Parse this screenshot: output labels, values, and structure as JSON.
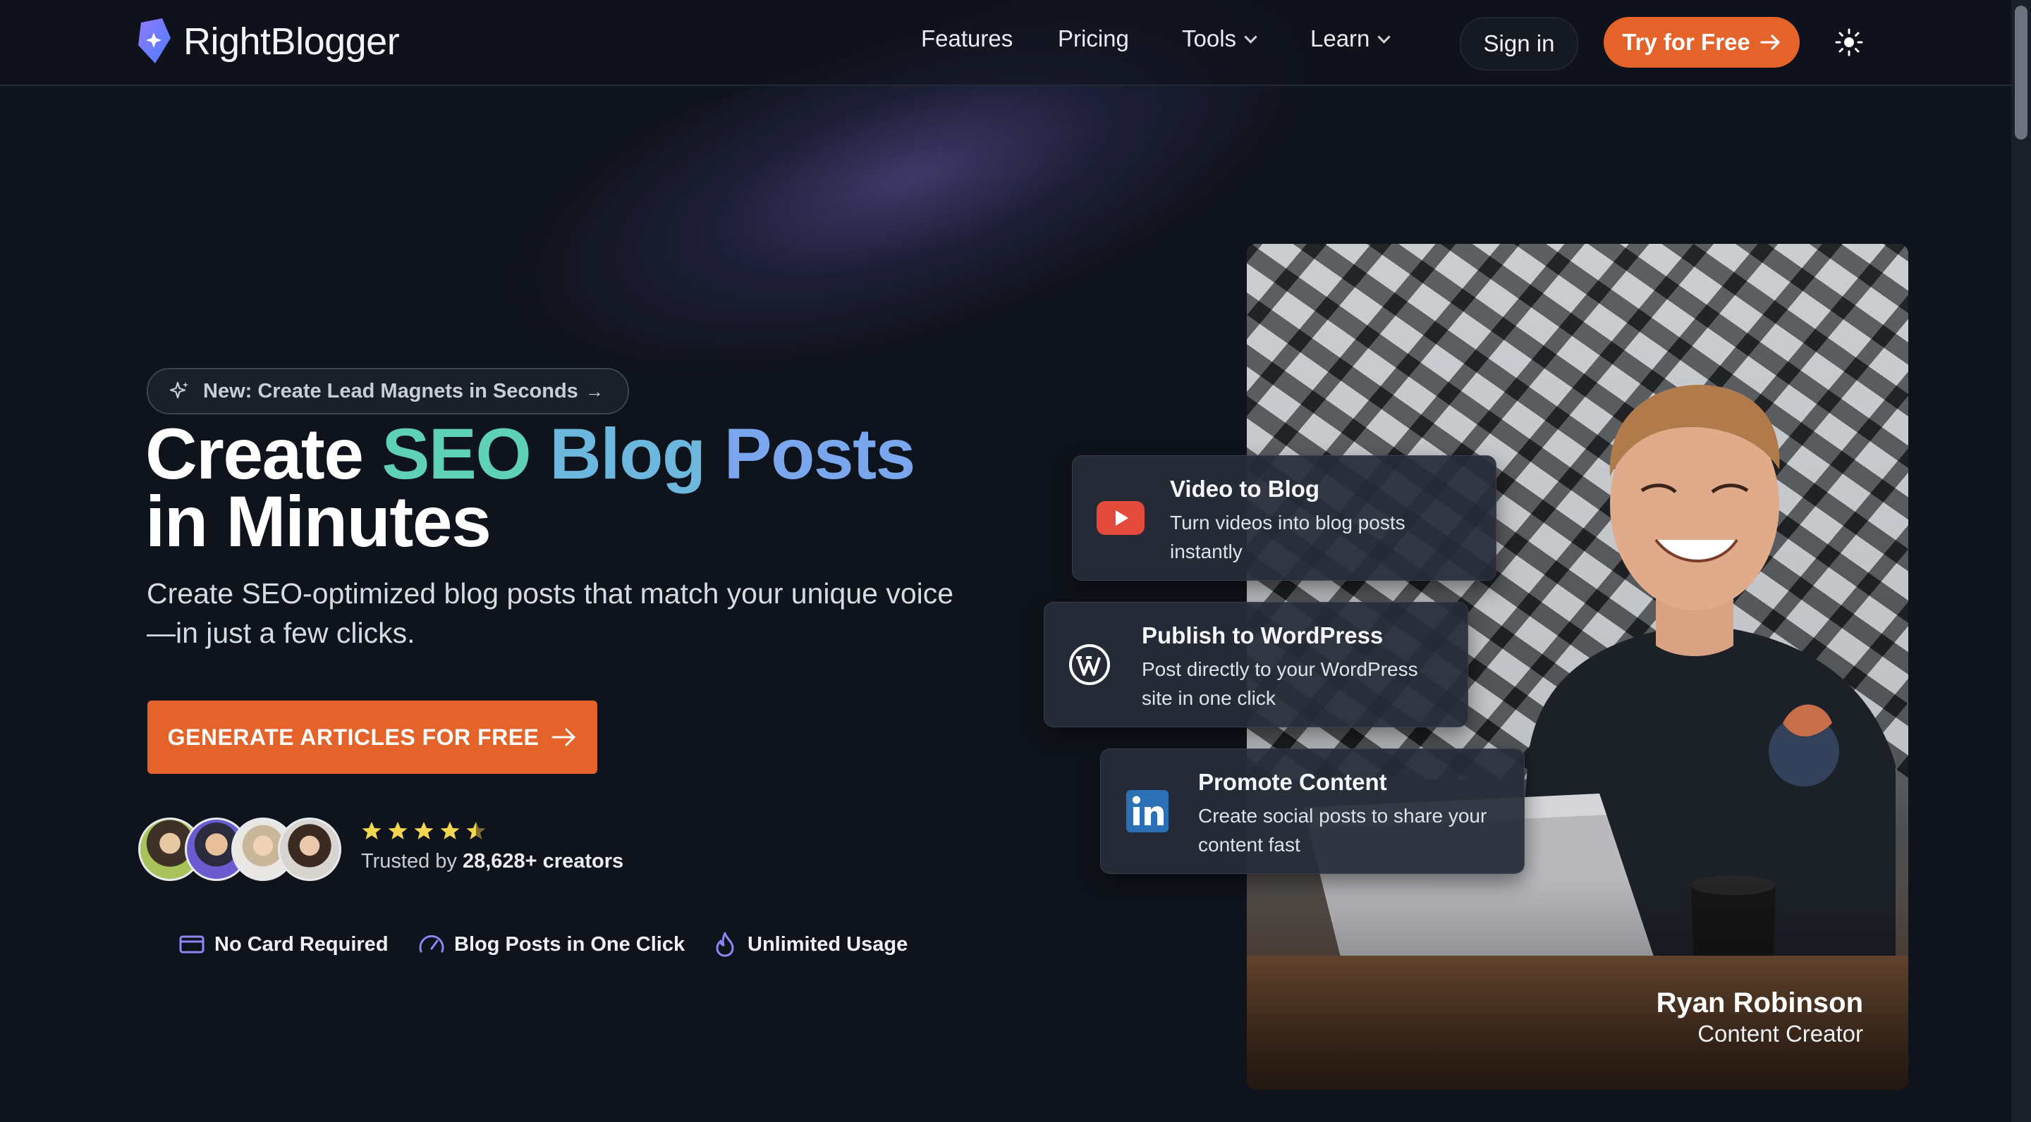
{
  "nav": {
    "logo_text": "RightBlogger",
    "links": [
      {
        "label": "Features"
      },
      {
        "label": "Pricing"
      },
      {
        "label": "Tools"
      },
      {
        "label": "Learn"
      }
    ],
    "sign_in": "Sign in",
    "try_free": "Try for Free"
  },
  "hero": {
    "badge": "New: Create Lead Magnets in Seconds",
    "headline_part1": "Create ",
    "headline_seo": "SEO",
    "headline_blog": "Blog",
    "headline_posts": "Posts",
    "headline_line2": "in Minutes",
    "subtitle": "Create SEO-optimized blog posts that match your unique voice—in just a few clicks.",
    "cta": "GENERATE ARTICLES FOR FREE",
    "rating_stars": 4.5,
    "trusted_prefix": "Trusted by ",
    "trusted_count": "28,628+ creators",
    "features": [
      {
        "label": "No Card Required",
        "icon": "credit-card-icon"
      },
      {
        "label": "Blog Posts in One Click",
        "icon": "speedometer-icon"
      },
      {
        "label": "Unlimited Usage",
        "icon": "flame-icon"
      }
    ]
  },
  "cards": [
    {
      "title": "Video to Blog",
      "desc": "Turn videos into blog posts instantly",
      "icon": "youtube-icon"
    },
    {
      "title": "Publish to WordPress",
      "desc": "Post directly to your WordPress site in one click",
      "icon": "wordpress-icon"
    },
    {
      "title": "Promote Content",
      "desc": "Create social posts to share your content fast",
      "icon": "linkedin-icon"
    }
  ],
  "testimonial": {
    "name": "Ryan Robinson",
    "role": "Content Creator"
  },
  "colors": {
    "accent": "#e4632a",
    "background": "#0f131b",
    "seo": "#5fd1b7",
    "blog": "#6cb7dd",
    "posts": "#7aa6ee"
  }
}
